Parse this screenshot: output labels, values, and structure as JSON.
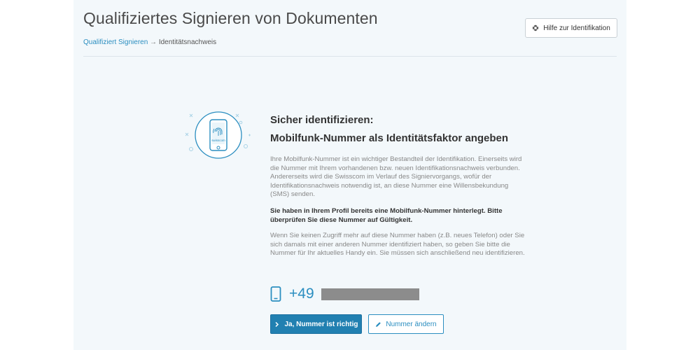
{
  "header": {
    "title": "Qualifiziertes Signieren von Dokumenten",
    "breadcrumb": {
      "link": "Qualifiziert Signieren",
      "separator": " → ",
      "current": "Identitätsnachweis"
    },
    "help_button": {
      "label": "Hilfe zur Identifikation",
      "icon": "lifebuoy-icon"
    }
  },
  "illustration": {
    "icon": "smartphone-fingerprint-icon",
    "brand_label": "swisscom"
  },
  "main": {
    "heading1": "Sicher identifizieren:",
    "heading2": "Mobilfunk-Nummer als Identitätsfaktor angeben",
    "paragraph1": "Ihre Mobilfunk-Nummer ist ein wichtiger Bestandteil der Identifikation. Einerseits wird die Nummer mit Ihrem vorhandenen bzw. neuen Identifikationsnachweis verbunden. Andererseits wird die Swisscom im Verlauf des Signiervorgangs, wofür der Identifikationsnachweis notwendig ist, an diese Nummer eine Willensbekundung (SMS) senden.",
    "paragraph2": "Sie haben in Ihrem Profil bereits eine Mobilfunk-Nummer hinterlegt. Bitte überprüfen Sie diese Nummer auf Gültigkeit.",
    "paragraph3": "Wenn Sie keinen Zugriff mehr auf diese Nummer haben (z.B. neues Telefon) oder Sie sich damals mit einer anderen Nummer identifiziert haben, so geben Sie bitte die Nummer für Ihr aktuelles Handy ein. Sie müssen sich anschließend neu identifizieren."
  },
  "phone": {
    "prefix": "+49",
    "icon": "mobile-phone-icon"
  },
  "actions": {
    "confirm_label": "Ja, Nummer ist richtig",
    "change_label": "Nummer ändern"
  },
  "colors": {
    "accent": "#2b8ec0",
    "primary_button": "#2180b1",
    "panel_bg": "#f3f8fb"
  }
}
